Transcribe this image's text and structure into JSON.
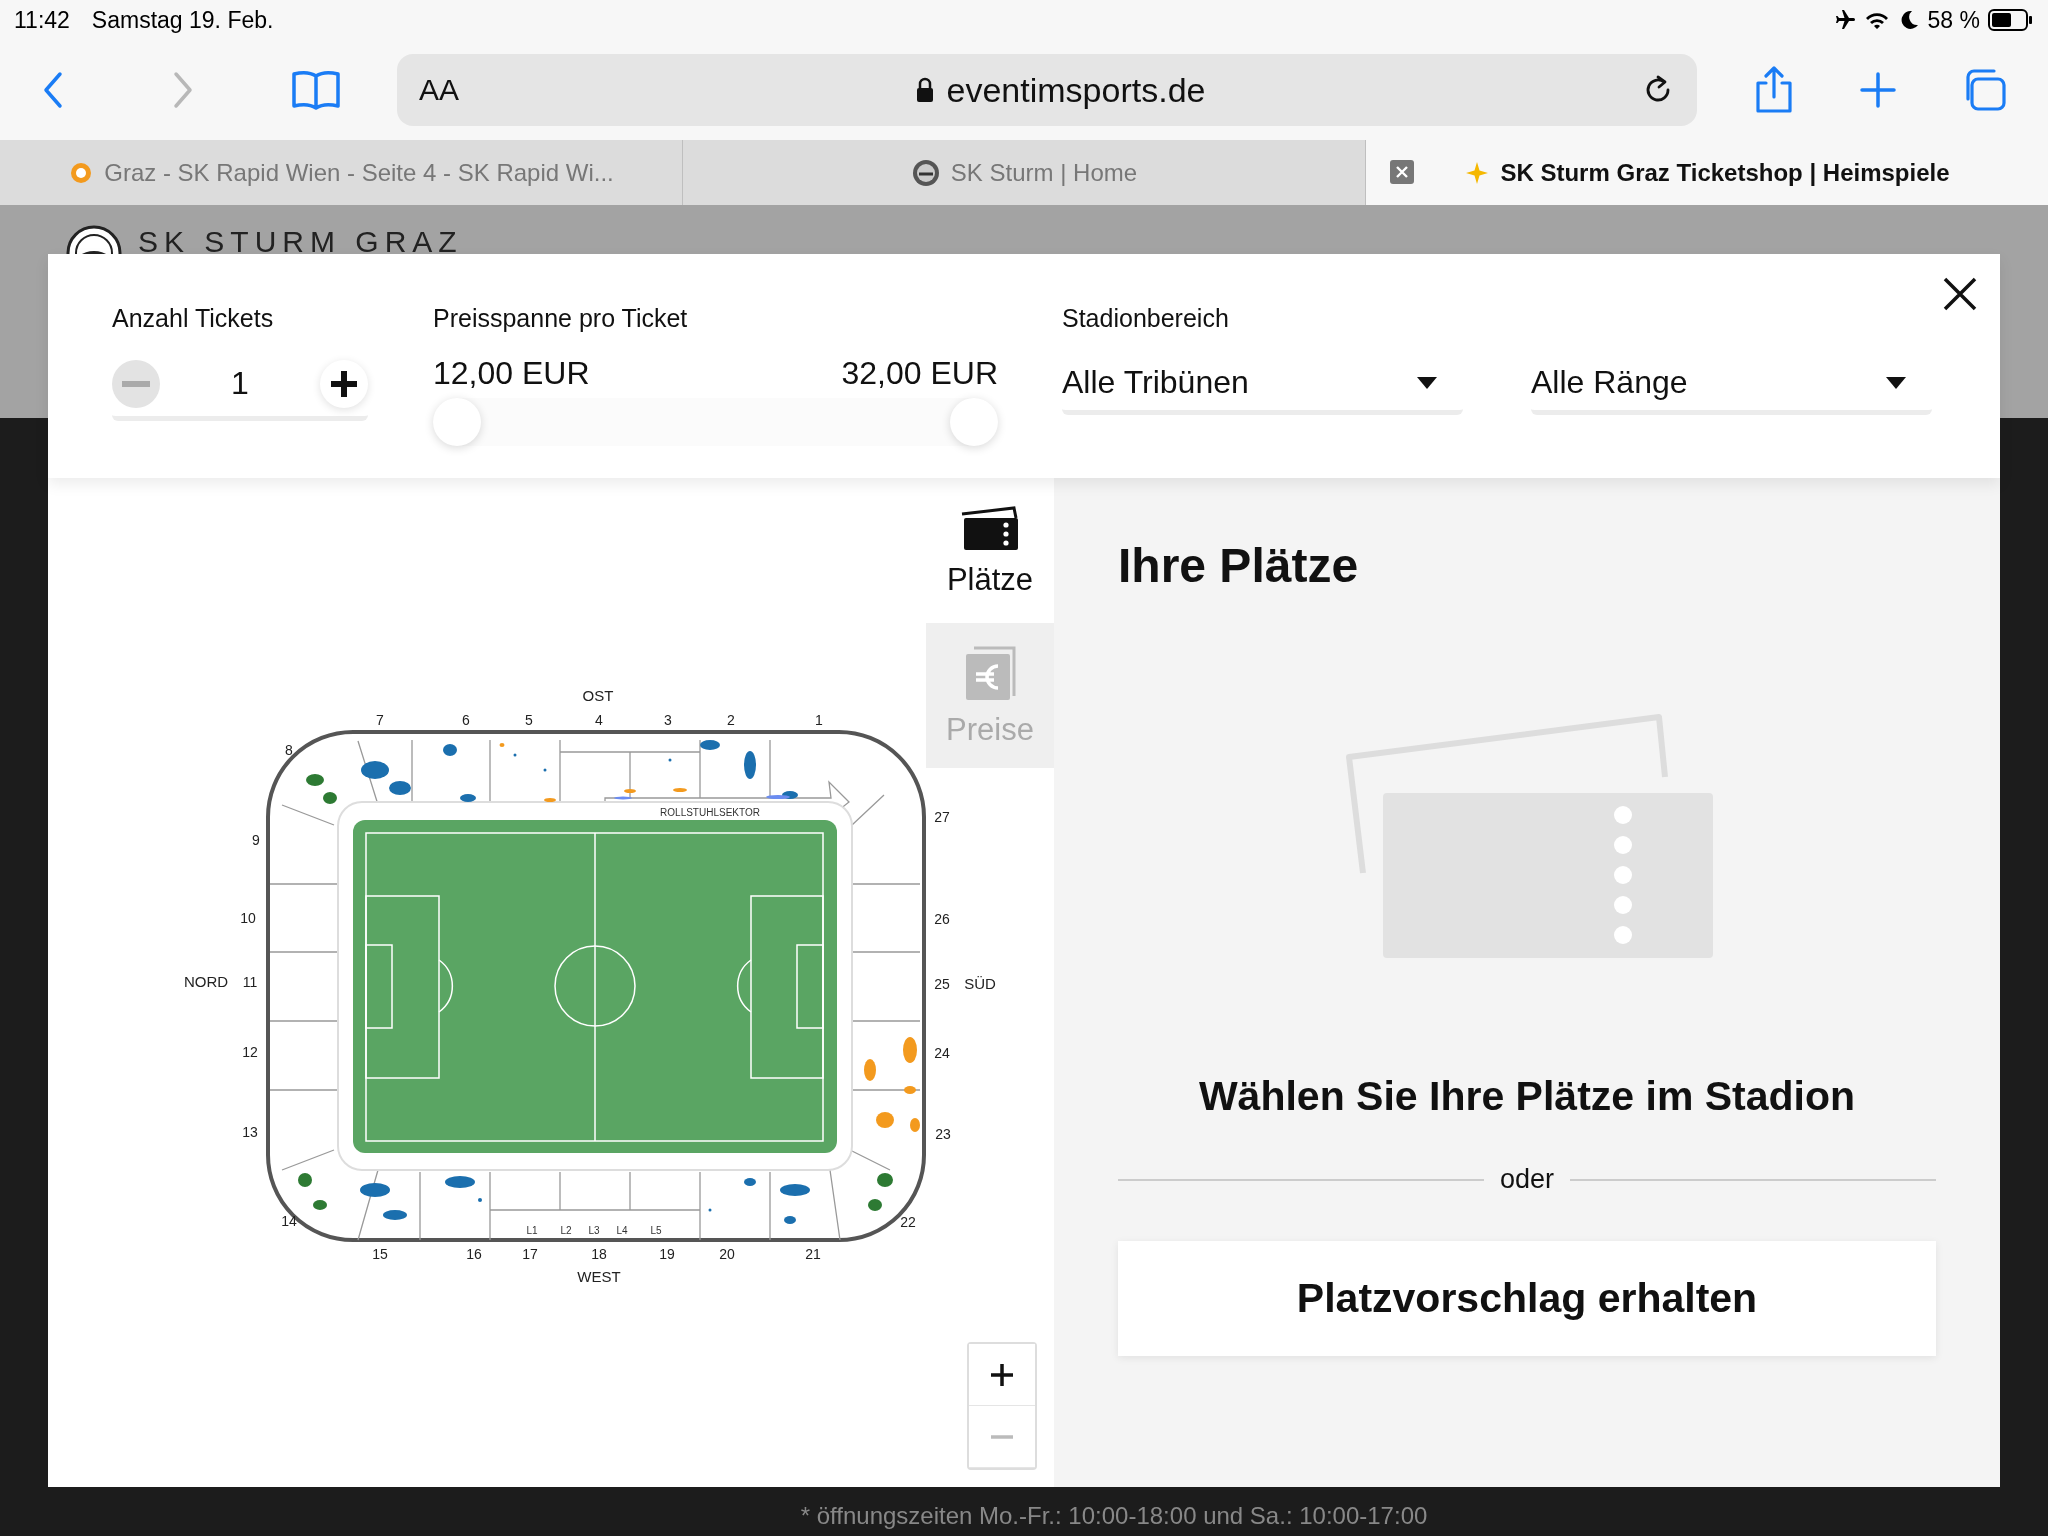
{
  "status_bar": {
    "time": "11:42",
    "date": "Samstag 19. Feb.",
    "battery": "58 %"
  },
  "toolbar": {
    "text_size": "AA",
    "url": "eventimsports.de",
    "forward_disabled": true
  },
  "browser_tabs": [
    {
      "title": "Graz - SK Rapid Wien - Seite 4 - SK Rapid Wi...",
      "selected": false
    },
    {
      "title": "SK Sturm | Home",
      "selected": false
    },
    {
      "title": "SK Sturm Graz Ticketshop | Heimspiele",
      "selected": true
    }
  ],
  "page": {
    "brand": "SK STURM GRAZ",
    "footer_note": "* öffnungszeiten Mo.-Fr.: 10:00-18:00 und Sa.: 10:00-17:00"
  },
  "filters": {
    "tickets": {
      "label": "Anzahl Tickets",
      "value": "1",
      "minus_disabled": true
    },
    "price": {
      "label": "Preisspanne pro Ticket",
      "min": "12,00 EUR",
      "max": "32,00 EUR",
      "thumbs": [
        {
          "level": 0
        },
        {
          "level": 1
        }
      ]
    },
    "area": {
      "label": "Stadionbereich",
      "dropdowns": [
        "Alle Tribünen",
        "Alle Ränge"
      ]
    }
  },
  "side_tabs": [
    {
      "label": "Plätze",
      "kind": "seats",
      "selected": true
    },
    {
      "label": "Preise",
      "kind": "prices",
      "selected": false
    }
  ],
  "stadium_map": {
    "sides": [
      "OST",
      "NORD",
      "SÜD",
      "WEST"
    ],
    "sector_numbers": {
      "ost": [
        "7",
        "6",
        "5",
        "4",
        "3",
        "2",
        "1"
      ],
      "nord": [
        "8",
        "9",
        "10",
        "11",
        "12",
        "13",
        "14"
      ],
      "sued": [
        "27",
        "26",
        "25",
        "24",
        "23",
        "22"
      ],
      "west": [
        "15",
        "16",
        "17",
        "18",
        "19",
        "20",
        "21"
      ]
    },
    "wheelchair_label": "ROLLSTUHLSEKTOR",
    "box_labels": [
      "L1",
      "L2",
      "L3",
      "L4",
      "L5"
    ]
  },
  "panel": {
    "title": "Ihre Plätze",
    "prompt": "Wählen Sie Ihre Plätze im Stadion",
    "divider": "oder",
    "button": "Platzvorschlag erhalten"
  }
}
